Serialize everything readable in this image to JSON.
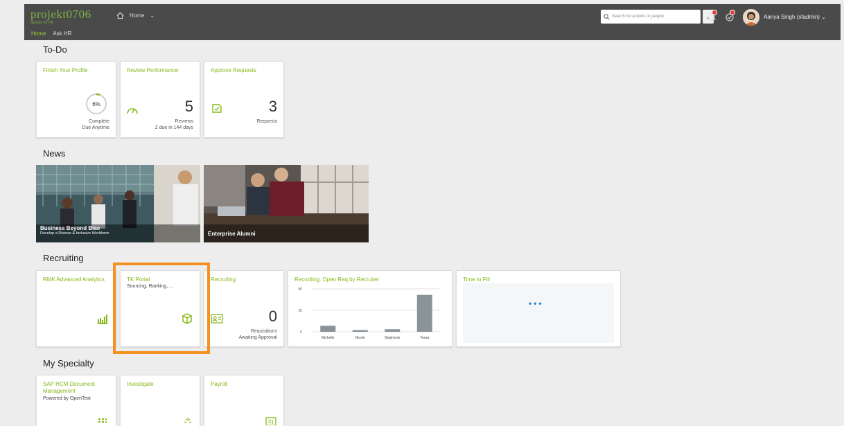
{
  "header": {
    "logo": "projekt0706",
    "logo_tagline": "passion for HR",
    "nav_home_label": "Home",
    "subnav": [
      "Home",
      "Ask HR"
    ],
    "search_placeholder": "Search for actions or people",
    "user_name": "Aanya Singh (sfadmin)",
    "notification_icon": "bell-icon",
    "todo_icon": "check-icon",
    "colors": {
      "bar": "#4a4a4a",
      "accent": "#86b817",
      "badge": "#e23b3b"
    }
  },
  "todo": {
    "title": "To-Do",
    "tiles": [
      {
        "title": "Finish Your Profile",
        "ring_label": "6%",
        "progress": 0.06,
        "foot1": "Complete",
        "foot2": "Due Anytime"
      },
      {
        "title": "Review Performance",
        "number": "5",
        "foot1": "Reviews",
        "foot2": "2 due in 144 days",
        "icon": "gauge-icon"
      },
      {
        "title": "Approve Requests",
        "number": "3",
        "foot1": "Requests",
        "icon": "approve-icon"
      }
    ]
  },
  "news": {
    "title": "News",
    "items": [
      {
        "title": "Business Beyond Bias",
        "subtitle": "Develop a Diverse & Inclusive Workforce"
      },
      {
        "title": "Enterprise Alumni"
      }
    ]
  },
  "recruiting": {
    "title": "Recruiting",
    "tiles": [
      {
        "title": "RMK Advanced Analytics",
        "icon": "analytics-chart-icon"
      },
      {
        "title": "TK Portal",
        "subtitle": "Sourcing, Ranking, ...",
        "icon": "cube-icon"
      },
      {
        "title": "Recruiting",
        "number": "0",
        "foot1": "Requisitions",
        "foot2": "Awaiting Approval",
        "icon": "requisition-icon"
      },
      {
        "title": "Recruiting: Open Req by Recruiter"
      },
      {
        "title": "Time to Fill"
      }
    ]
  },
  "chart_data": {
    "type": "bar",
    "title": "",
    "categories": [
      "Michelle",
      "Nicole",
      "Stephanie",
      "Tessa"
    ],
    "values": [
      7,
      2,
      3,
      43
    ],
    "ylim": [
      0,
      50
    ],
    "yticks": [
      "50",
      "25",
      "0"
    ],
    "grid": true,
    "color": "#8a9398"
  },
  "specialty": {
    "title": "My Specialty",
    "tiles": [
      {
        "title": "SAP HCM Document Management",
        "subtitle": "Powered by OpenText",
        "icon": "document-grid-icon"
      },
      {
        "title": "Investigate",
        "icon": "sparkle-icon"
      },
      {
        "title": "Payroll",
        "icon": "payroll-icon"
      }
    ]
  }
}
